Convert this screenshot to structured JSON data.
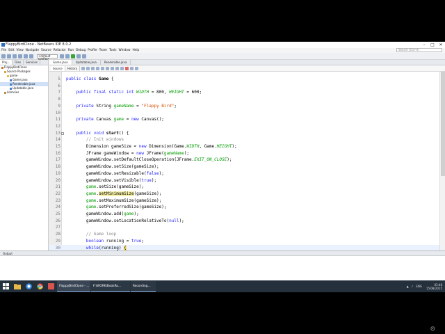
{
  "window": {
    "title": "FlappyBirdClone - NetBeans IDE 8.0.2"
  },
  "menu": {
    "items": [
      "File",
      "Edit",
      "View",
      "Navigate",
      "Source",
      "Refactor",
      "Run",
      "Debug",
      "Profile",
      "Team",
      "Tools",
      "Window",
      "Help"
    ],
    "search_placeholder": "Search (Ctrl+I)"
  },
  "toolbar": {
    "config": "<default config>"
  },
  "left_panel": {
    "tabs": [
      "Proj...",
      "Files",
      "Services"
    ],
    "tree": [
      "FlappyBirdClone",
      "Source Packages",
      "game",
      "Game.java",
      "Renderable.java",
      "Updatable.java",
      "Libraries"
    ]
  },
  "editor": {
    "tabs": [
      "Game.java",
      "Updatable.java",
      "Renderable.java"
    ],
    "source_tab": "Source",
    "history_tab": "History",
    "lines": [
      {
        "n": "5",
        "segs": [
          {
            "t": "public class ",
            "c": "kw"
          },
          {
            "t": "Game",
            "c": "b"
          },
          {
            "t": " {",
            "c": ""
          }
        ]
      },
      {
        "n": "6",
        "segs": [
          {
            "t": "",
            "c": ""
          }
        ]
      },
      {
        "n": "7",
        "segs": [
          {
            "t": "    public final static int ",
            "c": "kw"
          },
          {
            "t": "WIDTH",
            "c": "fld"
          },
          {
            "t": " = 800, ",
            "c": ""
          },
          {
            "t": "HEIGHT",
            "c": "fld"
          },
          {
            "t": " = 600;",
            "c": ""
          }
        ]
      },
      {
        "n": "8",
        "segs": [
          {
            "t": "",
            "c": ""
          }
        ]
      },
      {
        "n": "9",
        "segs": [
          {
            "t": "    private ",
            "c": "kw"
          },
          {
            "t": "String ",
            "c": ""
          },
          {
            "t": "gameName",
            "c": "fld2"
          },
          {
            "t": " = ",
            "c": ""
          },
          {
            "t": "\"Flappy Bird\"",
            "c": "str"
          },
          {
            "t": ";",
            "c": ""
          }
        ]
      },
      {
        "n": "10",
        "segs": [
          {
            "t": "",
            "c": ""
          }
        ]
      },
      {
        "n": "11",
        "segs": [
          {
            "t": "    private ",
            "c": "kw"
          },
          {
            "t": "Canvas ",
            "c": ""
          },
          {
            "t": "game",
            "c": "fld2"
          },
          {
            "t": " = ",
            "c": ""
          },
          {
            "t": "new ",
            "c": "kw"
          },
          {
            "t": "Canvas();",
            "c": ""
          }
        ]
      },
      {
        "n": "12",
        "segs": [
          {
            "t": "",
            "c": ""
          }
        ]
      },
      {
        "n": "13",
        "segs": [
          {
            "t": "    public void ",
            "c": "kw"
          },
          {
            "t": "start",
            "c": "b"
          },
          {
            "t": "() {",
            "c": ""
          }
        ]
      },
      {
        "n": "14",
        "segs": [
          {
            "t": "        // Init windows",
            "c": "cm"
          }
        ]
      },
      {
        "n": "15",
        "segs": [
          {
            "t": "        Dimension gameSize = ",
            "c": ""
          },
          {
            "t": "new ",
            "c": "kw"
          },
          {
            "t": "Dimension(Game.",
            "c": ""
          },
          {
            "t": "WIDTH",
            "c": "fld"
          },
          {
            "t": ", Game.",
            "c": ""
          },
          {
            "t": "HEIGHT",
            "c": "fld"
          },
          {
            "t": ");",
            "c": ""
          }
        ]
      },
      {
        "n": "16",
        "segs": [
          {
            "t": "        JFrame gameWindow = ",
            "c": ""
          },
          {
            "t": "new ",
            "c": "kw"
          },
          {
            "t": "JFrame(",
            "c": ""
          },
          {
            "t": "gameName",
            "c": "fld2"
          },
          {
            "t": ");",
            "c": ""
          }
        ]
      },
      {
        "n": "17",
        "segs": [
          {
            "t": "        gameWindow.setDefaultCloseOperation(JFrame.",
            "c": ""
          },
          {
            "t": "EXIT_ON_CLOSE",
            "c": "fld"
          },
          {
            "t": ");",
            "c": ""
          }
        ]
      },
      {
        "n": "18",
        "segs": [
          {
            "t": "        gameWindow.setSize(gameSize);",
            "c": ""
          }
        ]
      },
      {
        "n": "19",
        "segs": [
          {
            "t": "        gameWindow.setResizable(",
            "c": ""
          },
          {
            "t": "false",
            "c": "kw"
          },
          {
            "t": ");",
            "c": ""
          }
        ]
      },
      {
        "n": "20",
        "segs": [
          {
            "t": "        gameWindow.setVisible(",
            "c": ""
          },
          {
            "t": "true",
            "c": "kw"
          },
          {
            "t": ");",
            "c": ""
          }
        ]
      },
      {
        "n": "21",
        "segs": [
          {
            "t": "        ",
            "c": ""
          },
          {
            "t": "game",
            "c": "fld2"
          },
          {
            "t": ".setSize(gameSize);",
            "c": ""
          }
        ]
      },
      {
        "n": "22",
        "segs": [
          {
            "t": "        ",
            "c": ""
          },
          {
            "t": "game",
            "c": "fld2"
          },
          {
            "t": ".",
            "c": ""
          },
          {
            "t": "setMinimumSize",
            "c": "mhl"
          },
          {
            "t": "(gameSize);",
            "c": ""
          }
        ]
      },
      {
        "n": "23",
        "segs": [
          {
            "t": "        ",
            "c": ""
          },
          {
            "t": "game",
            "c": "fld2"
          },
          {
            "t": ".setMaximumSize(gameSize);",
            "c": ""
          }
        ]
      },
      {
        "n": "24",
        "segs": [
          {
            "t": "        ",
            "c": ""
          },
          {
            "t": "game",
            "c": "fld2"
          },
          {
            "t": ".setPreferredSize(gameSize);",
            "c": ""
          }
        ]
      },
      {
        "n": "25",
        "segs": [
          {
            "t": "        gameWindow.add(",
            "c": ""
          },
          {
            "t": "game",
            "c": "fld2"
          },
          {
            "t": ");",
            "c": ""
          }
        ]
      },
      {
        "n": "26",
        "segs": [
          {
            "t": "        gameWindow.setLocationRelativeTo(",
            "c": ""
          },
          {
            "t": "null",
            "c": "kw"
          },
          {
            "t": ");",
            "c": ""
          }
        ]
      },
      {
        "n": "27",
        "segs": [
          {
            "t": "",
            "c": ""
          }
        ]
      },
      {
        "n": "28",
        "segs": [
          {
            "t": "        // Game loop",
            "c": "cm"
          }
        ]
      },
      {
        "n": "29",
        "segs": [
          {
            "t": "        boolean ",
            "c": "kw"
          },
          {
            "t": "running = ",
            "c": ""
          },
          {
            "t": "true",
            "c": "kw"
          },
          {
            "t": ";",
            "c": ""
          }
        ]
      },
      {
        "n": "30",
        "segs": [
          {
            "t": "        ",
            "c": ""
          },
          {
            "t": "while",
            "c": "kw"
          },
          {
            "t": "(running) ",
            "c": ""
          },
          {
            "t": "{",
            "c": "cur"
          }
        ]
      }
    ]
  },
  "output": {
    "tab": "Output"
  },
  "taskbar": {
    "buttons": [
      "FlappyBirdClone - ...",
      "F:\\WORK\\BookRo...",
      "Recording..."
    ],
    "tray_lang": "ENG",
    "time": "03:48",
    "date": "15/08/2015"
  }
}
